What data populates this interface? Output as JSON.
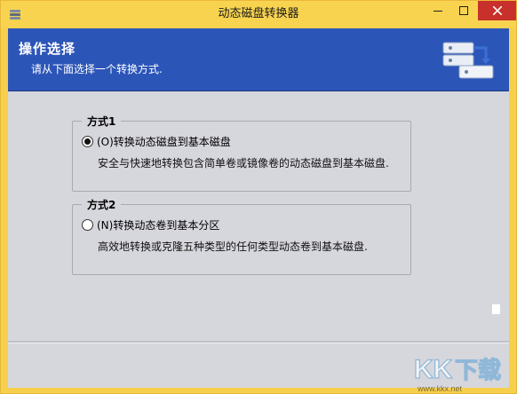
{
  "window": {
    "title": "动态磁盘转换器",
    "controls": {
      "minimize": "minimize",
      "maximize": "maximize",
      "close": "close"
    }
  },
  "header": {
    "title": "操作选择",
    "subtitle": "请从下面选择一个转换方式."
  },
  "options": [
    {
      "group_label": "方式1",
      "label": "(O)转换动态磁盘到基本磁盘",
      "description": "安全与快速地转换包含简单卷或镜像卷的动态磁盘到基本磁盘.",
      "selected": true
    },
    {
      "group_label": "方式2",
      "label": "(N)转换动态卷到基本分区",
      "description": "高效地转换或克隆五种类型的任何类型动态卷到基本磁盘.",
      "selected": false
    }
  ],
  "watermark": {
    "text": "KK下载",
    "url": "www.kkx.net"
  },
  "colors": {
    "titlebar": "#f8d34f",
    "header_bg": "#2c55b8",
    "client_bg": "#d6d6dd",
    "close_button": "#c7302b"
  },
  "icons": {
    "app": "disk-stack-icon",
    "header": "disk-convert-icon"
  }
}
